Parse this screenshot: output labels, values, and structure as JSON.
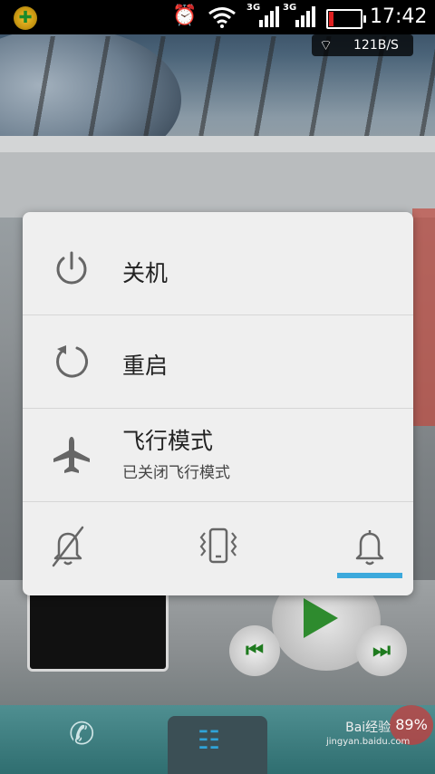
{
  "status_bar": {
    "time": "17:42",
    "signal1_label": "3G",
    "signal2_label": "3G",
    "net_speed": "121B/S",
    "icons": [
      "app-icon",
      "alarm-icon",
      "wifi-icon",
      "signal-icon",
      "signal-icon",
      "battery-icon"
    ]
  },
  "power_menu": {
    "items": [
      {
        "icon": "power-icon",
        "label": "关机"
      },
      {
        "icon": "restart-icon",
        "label": "重启"
      },
      {
        "icon": "airplane-icon",
        "label": "飞行模式",
        "subtitle": "已关闭飞行模式"
      }
    ],
    "sound_modes": [
      {
        "icon": "mute-icon",
        "name": "silent"
      },
      {
        "icon": "vibrate-icon",
        "name": "vibrate"
      },
      {
        "icon": "bell-icon",
        "name": "sound"
      }
    ],
    "selected_sound_mode": "sound",
    "accent_color": "#3ca9dc"
  },
  "background": {
    "battery_badge": "89%",
    "watermark_title": "Bai经验",
    "watermark_url": "jingyan.baidu.com"
  }
}
